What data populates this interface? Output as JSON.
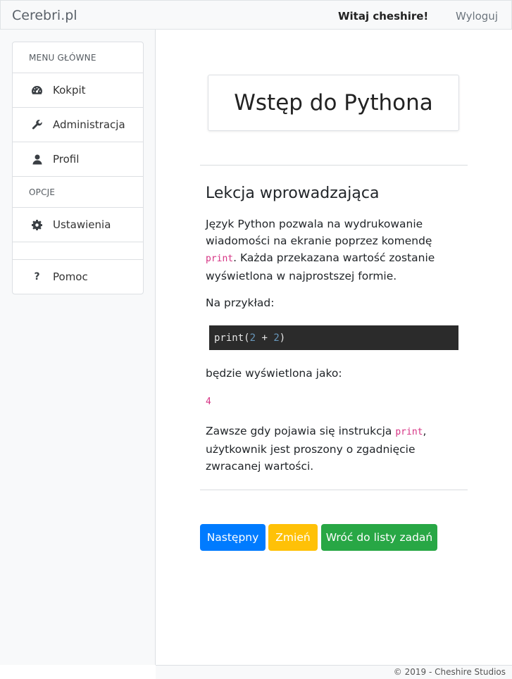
{
  "navbar": {
    "brand": "Cerebri.pl",
    "welcome": "Witaj cheshire!",
    "logout": "Wyloguj"
  },
  "sidebar": {
    "main_header": "MENU GŁÓWNE",
    "items": [
      {
        "label": "Kokpit",
        "icon": "dashboard-icon"
      },
      {
        "label": "Administracja",
        "icon": "wrench-icon"
      },
      {
        "label": "Profil",
        "icon": "user-icon"
      }
    ],
    "options_header": "OPCJE",
    "options": [
      {
        "label": "Ustawienia",
        "icon": "gear-icon"
      }
    ],
    "help": {
      "label": "Pomoc",
      "icon": "question-icon"
    }
  },
  "main": {
    "title": "Wstęp do Pythona",
    "lesson_title": "Lekcja wprowadzająca",
    "p1_text": "Język Python pozwala na wydrukowanie wiadomości na ekranie poprzez komendę ",
    "p1_code": "print",
    "p1_after": ". Każda przekazana wartość zostanie wyświetlona w najprostszej formie.",
    "p2": "Na przykład:",
    "code_block": {
      "fn": "print(",
      "a": "2",
      "op": " + ",
      "b": "2",
      "close": ")"
    },
    "p3": "będzie wyświetlona jako:",
    "output": "4",
    "p4_before": "Zawsze gdy pojawia się instrukcja ",
    "p4_code": "print",
    "p4_after": ", użytkownik jest proszony o zgadnięcie zwracanej wartości."
  },
  "buttons": {
    "next": "Następny",
    "edit": "Zmień",
    "back": "Wróć do listy zadań"
  },
  "footer": "© 2019 - Cheshire Studios",
  "colors": {
    "primary": "#007bff",
    "warning": "#ffc107",
    "success": "#28a745",
    "code_pink": "#d63384",
    "code_bg": "#2b2b2b"
  }
}
